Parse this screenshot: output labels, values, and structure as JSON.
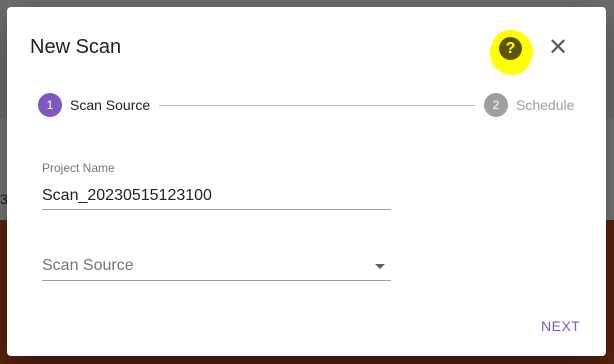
{
  "background": {
    "edge_text": "3"
  },
  "dialog": {
    "title": "New Scan",
    "help_icon_glyph": "?",
    "close_icon_glyph": "✕",
    "highlight_color": "#ffff00"
  },
  "stepper": {
    "steps": [
      {
        "number": "1",
        "label": "Scan Source",
        "state": "active",
        "color": "#7e57c2"
      },
      {
        "number": "2",
        "label": "Schedule",
        "state": "inactive",
        "color": "#9e9e9e"
      }
    ]
  },
  "form": {
    "project_name": {
      "label": "Project Name",
      "value": "Scan_20230515123100"
    },
    "scan_source": {
      "placeholder": "Scan Source",
      "value": ""
    }
  },
  "actions": {
    "next_label": "NEXT"
  },
  "colors": {
    "accent": "#7e57c2",
    "text": "#212121",
    "muted": "#757575"
  }
}
